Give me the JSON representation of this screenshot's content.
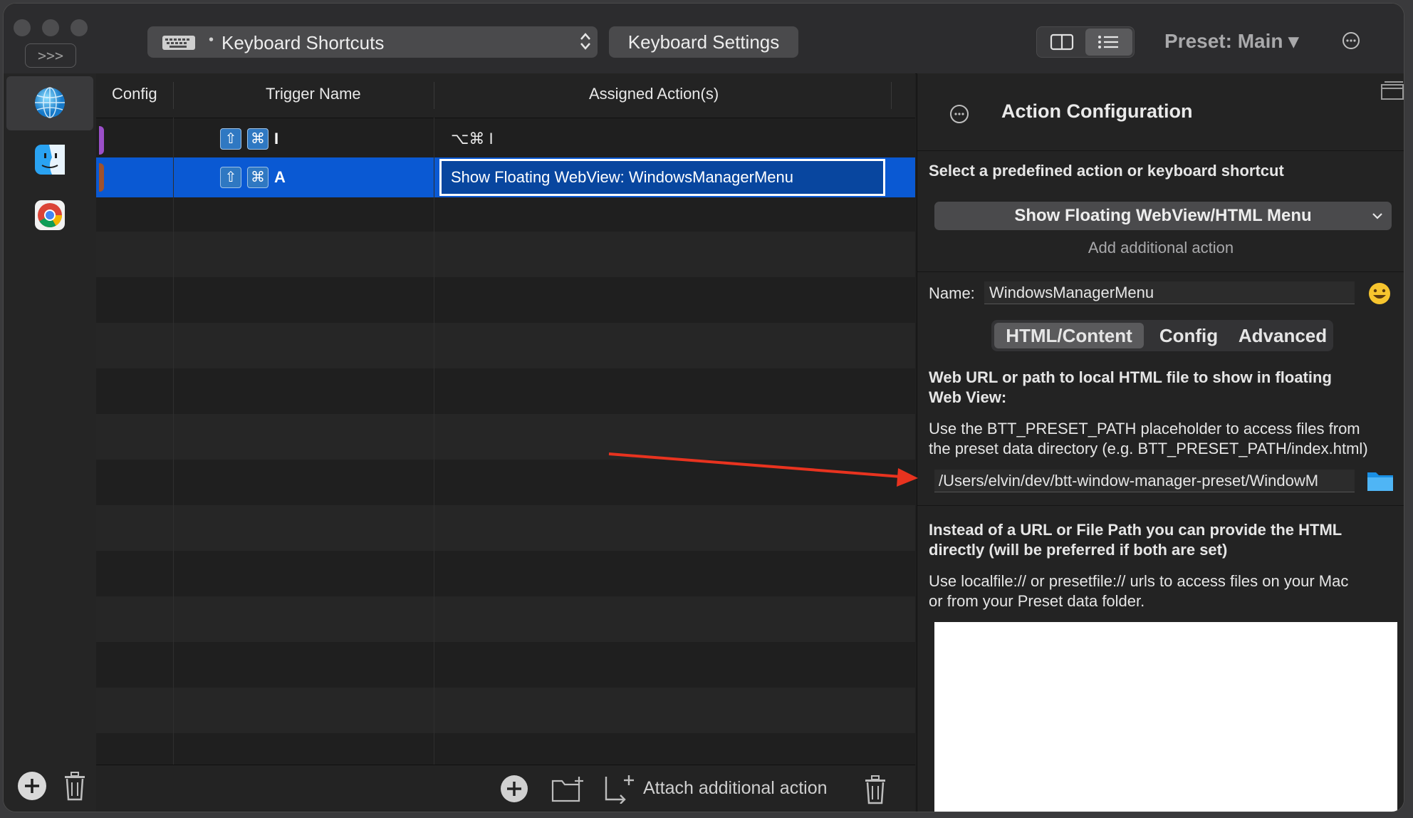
{
  "titlebar": {
    "sidebar_toggle": ">>>",
    "trigger_type": "Keyboard Shortcuts",
    "keyboard_settings": "Keyboard Settings",
    "preset": "Preset: Main ▾"
  },
  "apps": [
    "global-icon",
    "finder-icon",
    "chrome-icon"
  ],
  "table": {
    "headers": {
      "config": "Config",
      "trigger": "Trigger Name",
      "actions": "Assigned Action(s)"
    },
    "rows": [
      {
        "keys": [
          "⇧",
          "⌘"
        ],
        "key": "I",
        "action": "⌥⌘ I",
        "tag_color": "#9b4fc9"
      },
      {
        "keys": [
          "⇧",
          "⌘"
        ],
        "key": "A",
        "action": "Show Floating WebView: WindowsManagerMenu",
        "tag_color": "#a0522d"
      }
    ]
  },
  "toolbar": {
    "attach": "Attach additional action"
  },
  "panel": {
    "title": "Action Configuration",
    "select_label": "Select a predefined action or keyboard shortcut",
    "selected_action": "Show Floating WebView/HTML Menu",
    "add_additional": "Add additional action",
    "name_label": "Name:",
    "name_value": "WindowsManagerMenu",
    "tabs": [
      "HTML/Content",
      "Config",
      "Advanced"
    ],
    "url_heading_1": "Web URL or path to local HTML file to show in floating",
    "url_heading_2": "Web View:",
    "url_help_1": "Use the BTT_PRESET_PATH placeholder to access files from",
    "url_help_2": "the preset data directory (e.g. BTT_PRESET_PATH/index.html)",
    "url_value": "/Users/elvin/dev/btt-window-manager-preset/WindowM",
    "html_heading_1": "Instead of a URL or File Path you can provide the HTML",
    "html_heading_2": "directly (will be preferred if both are set)",
    "html_help_1": "Use localfile:// or presetfile:// urls to access files on your Mac",
    "html_help_2": "or from your Preset data folder."
  },
  "colors": {
    "selection": "#0a59d3",
    "accent_arrow": "#e8331f"
  }
}
